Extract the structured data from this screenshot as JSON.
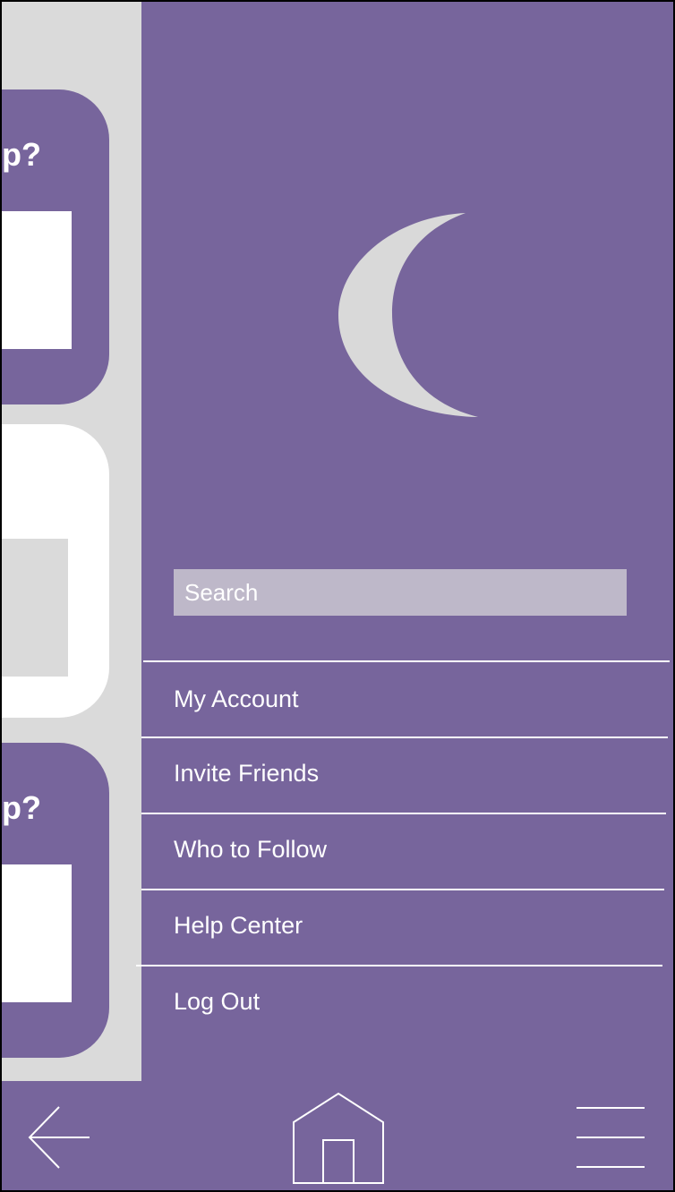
{
  "feed": {
    "cards": [
      {
        "question_fragment": "p?"
      },
      {
        "question_fragment": ""
      },
      {
        "question_fragment": "p?"
      }
    ]
  },
  "drawer": {
    "logo_icon": "crescent-moon-icon",
    "search": {
      "placeholder": "Search",
      "value": ""
    },
    "menu_items": [
      {
        "label": "My Account"
      },
      {
        "label": "Invite Friends"
      },
      {
        "label": "Who to Follow"
      },
      {
        "label": "Help Center"
      },
      {
        "label": "Log Out"
      }
    ]
  },
  "bottom_nav": {
    "back_icon": "arrow-left-icon",
    "home_icon": "home-icon",
    "menu_icon": "hamburger-menu-icon"
  },
  "colors": {
    "primary_purple": "#77659c",
    "search_bg": "#beb8c9",
    "background_gray": "#dadada",
    "moon": "#d9d9d9",
    "text": "#ffffff"
  }
}
